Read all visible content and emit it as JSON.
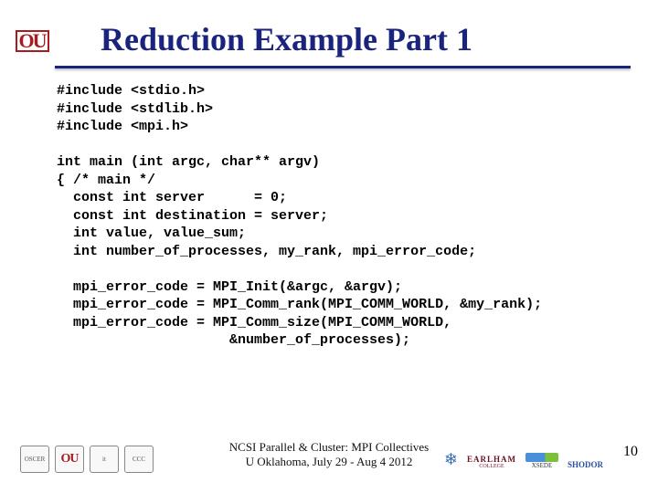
{
  "logo": {
    "ou_text": "OU"
  },
  "title": "Reduction Example Part 1",
  "code": "#include <stdio.h>\n#include <stdlib.h>\n#include <mpi.h>\n\nint main (int argc, char** argv)\n{ /* main */\n  const int server      = 0;\n  const int destination = server;\n  int value, value_sum;\n  int number_of_processes, my_rank, mpi_error_code;\n\n  mpi_error_code = MPI_Init(&argc, &argv);\n  mpi_error_code = MPI_Comm_rank(MPI_COMM_WORLD, &my_rank);\n  mpi_error_code = MPI_Comm_size(MPI_COMM_WORLD,\n                     &number_of_processes);",
  "footer": {
    "left_badges": [
      "OSCER",
      "OU",
      "it",
      "CCC"
    ],
    "center_line1": "NCSI Parallel & Cluster: MPI Collectives",
    "center_line2": "U Oklahoma, July 29 - Aug 4 2012",
    "right": {
      "earlham": "EARLHAM",
      "earlham_sub": "COLLEGE",
      "xsede": "XSEDE",
      "shodor": "SHODOR"
    }
  },
  "page_number": "10"
}
